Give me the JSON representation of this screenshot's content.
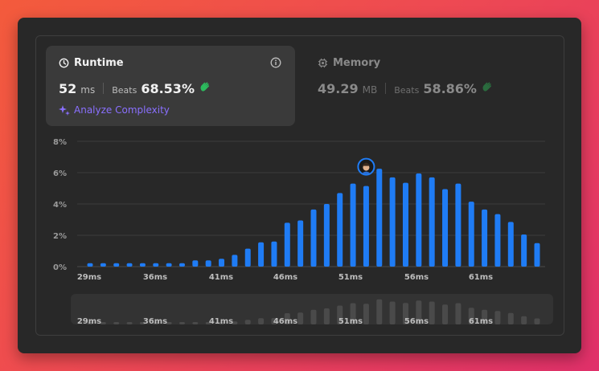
{
  "runtime": {
    "title": "Runtime",
    "value": "52",
    "unit": "ms",
    "beats_label": "Beats",
    "beats_pct": "68.53%",
    "analyze_label": "Analyze Complexity"
  },
  "memory": {
    "title": "Memory",
    "value": "49.29",
    "unit": "MB",
    "beats_label": "Beats",
    "beats_pct": "58.86%"
  },
  "colors": {
    "bar": "#1f7cf5",
    "accent": "#8a70ff",
    "beats_icon": "#2cbb5d"
  },
  "icons": [
    "clock-icon",
    "info-icon",
    "chip-icon",
    "sparkle-icon",
    "avatar"
  ],
  "chart_data": {
    "type": "bar",
    "y_ticks": [
      "8%",
      "6%",
      "4%",
      "2%",
      "0%"
    ],
    "ylim": [
      0,
      8
    ],
    "x_tick_labels": [
      "29ms",
      "36ms",
      "41ms",
      "46ms",
      "51ms",
      "56ms",
      "61ms"
    ],
    "values": [
      0.22,
      0.22,
      0.22,
      0.22,
      0.22,
      0.22,
      0.22,
      0.22,
      0.4,
      0.4,
      0.5,
      0.75,
      1.15,
      1.55,
      1.6,
      2.8,
      2.95,
      3.65,
      4.0,
      4.7,
      5.3,
      5.15,
      6.25,
      5.7,
      5.35,
      5.95,
      5.7,
      4.95,
      5.3,
      4.15,
      3.65,
      3.35,
      2.85,
      2.05,
      1.5
    ],
    "highlight_index": 21,
    "grid": true
  }
}
